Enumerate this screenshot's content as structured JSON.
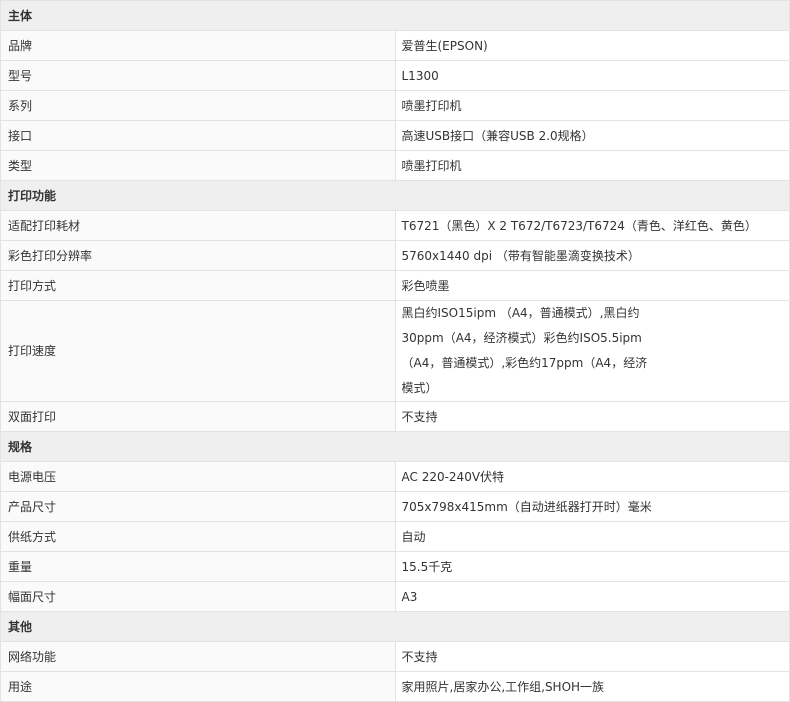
{
  "sections": [
    {
      "title": "主体",
      "rows": [
        {
          "label": "品牌",
          "value": "爱普生(EPSON)"
        },
        {
          "label": "型号",
          "value": "L1300"
        },
        {
          "label": "系列",
          "value": "喷墨打印机"
        },
        {
          "label": "接口",
          "value": "高速USB接口（兼容USB 2.0规格）"
        },
        {
          "label": "类型",
          "value": "喷墨打印机"
        }
      ]
    },
    {
      "title": "打印功能",
      "rows": [
        {
          "label": "适配打印耗材",
          "value": "T6721（黑色）X 2 T672/T6723/T6724（青色、洋红色、黄色）"
        },
        {
          "label": "彩色打印分辨率",
          "value": "5760x1440 dpi （带有智能墨滴变换技术）"
        },
        {
          "label": "打印方式",
          "value": "彩色喷墨"
        },
        {
          "label": "打印速度",
          "value": "黑白约ISO15ipm （A4，普通模式）,黑白约30ppm（A4，经济模式）彩色约ISO5.5ipm （A4，普通模式）,彩色约17ppm（A4，经济模式）"
        },
        {
          "label": "双面打印",
          "value": "不支持"
        }
      ]
    },
    {
      "title": "规格",
      "rows": [
        {
          "label": "电源电压",
          "value": "AC 220-240V伏特"
        },
        {
          "label": "产品尺寸",
          "value": "705x798x415mm（自动进纸器打开时）毫米"
        },
        {
          "label": "供纸方式",
          "value": "自动"
        },
        {
          "label": "重量",
          "value": "15.5千克"
        },
        {
          "label": "幅面尺寸",
          "value": "A3"
        }
      ]
    },
    {
      "title": "其他",
      "rows": [
        {
          "label": "网络功能",
          "value": "不支持"
        },
        {
          "label": "用途",
          "value": "家用照片,居家办公,工作组,SHOH一族"
        }
      ]
    }
  ]
}
